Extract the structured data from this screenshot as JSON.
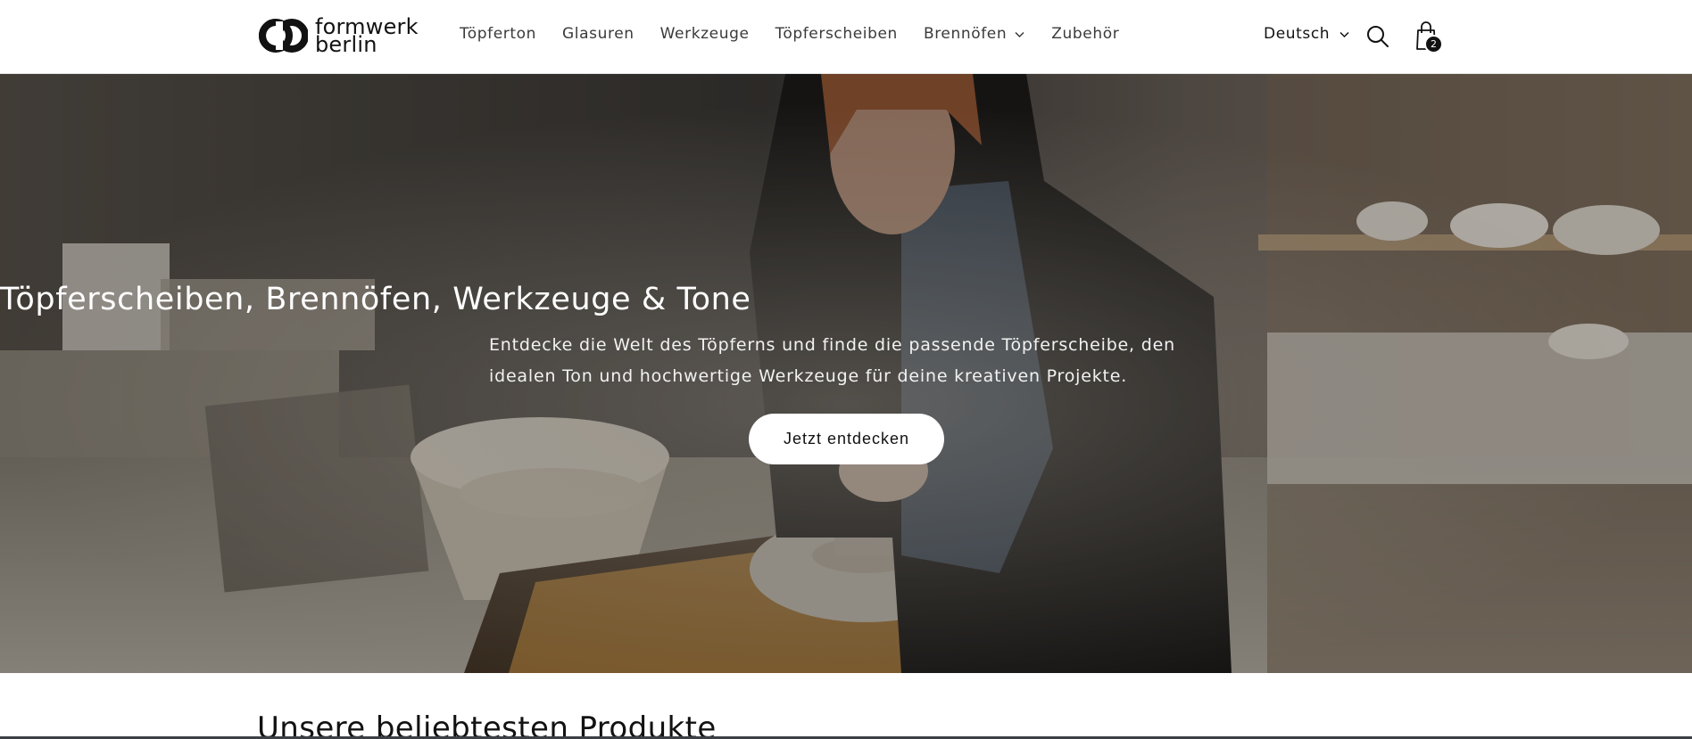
{
  "brand": {
    "line1": "formwerk",
    "line2": "berlin"
  },
  "nav": {
    "items": [
      {
        "label": "Töpferton"
      },
      {
        "label": "Glasuren"
      },
      {
        "label": "Werkzeuge"
      },
      {
        "label": "Töpferscheiben"
      },
      {
        "label": "Brennöfen",
        "has_dropdown": true
      },
      {
        "label": "Zubehör"
      }
    ]
  },
  "header": {
    "language": "Deutsch",
    "search_icon": "search-icon",
    "cart_icon": "shopping-bag-icon",
    "cart_count": "2"
  },
  "hero": {
    "title": "Töpferscheiben, Brennöfen, Werkzeuge & Tone",
    "subtitle": "Entdecke die Welt des Töpferns und finde die passende Töpferscheibe, den idealen Ton und hochwertige Werkzeuge für deine kreativen Projekte.",
    "cta": "Jetzt entdecken"
  },
  "products": {
    "heading": "Unsere beliebtesten Produkte"
  },
  "colors": {
    "text": "#121212",
    "background": "#ffffff",
    "cart_badge": "#121212"
  }
}
